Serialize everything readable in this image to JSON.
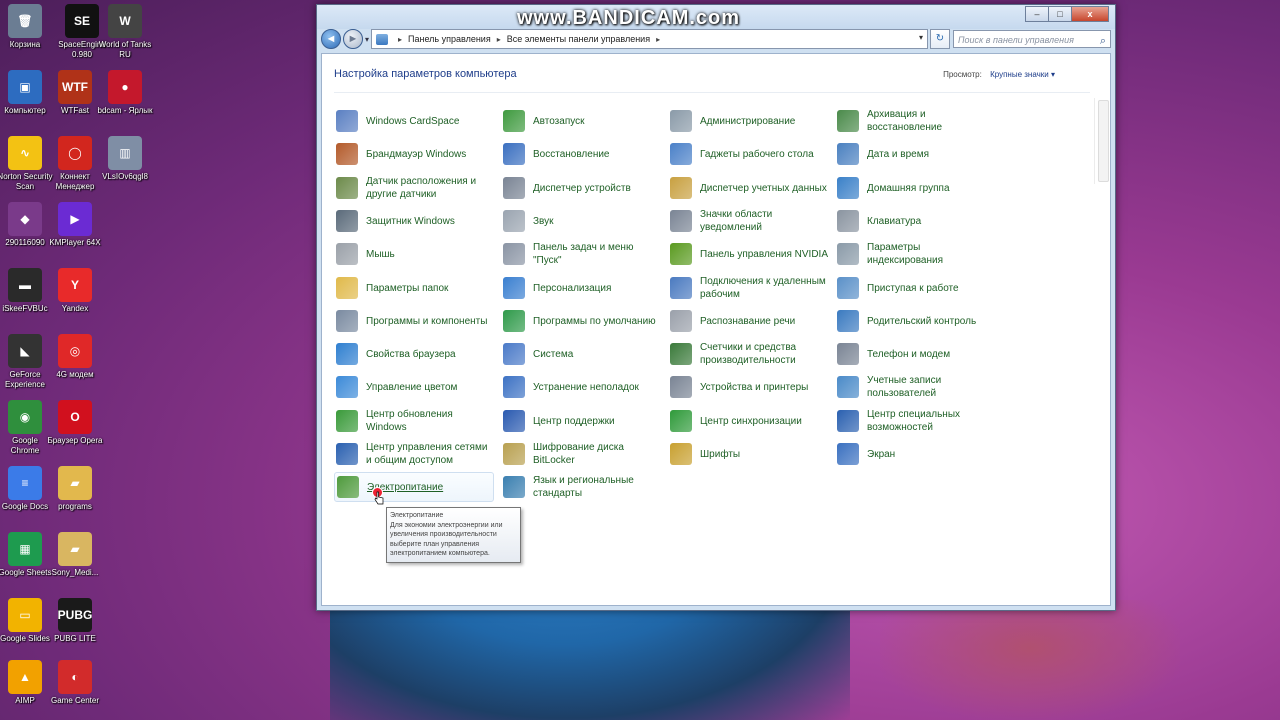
{
  "watermark": "www.BANDICAM.com",
  "desktop_icons": [
    {
      "label": "Корзина",
      "symbol": "🗑",
      "color": "#6b7d93"
    },
    {
      "label": "SpaceEngine 0.980",
      "symbol": "SE",
      "color": "#111111"
    },
    {
      "label": "World of Tanks RU",
      "symbol": "W",
      "color": "#444444"
    },
    {
      "label": "Компьютер",
      "symbol": "▣",
      "color": "#2d6cc0"
    },
    {
      "label": "WTFast",
      "symbol": "WTF",
      "color": "#b03218"
    },
    {
      "label": "bdcam - Ярлык",
      "symbol": "●",
      "color": "#c4182c"
    },
    {
      "label": "Norton Security Scan",
      "symbol": "∿",
      "color": "#f3c213"
    },
    {
      "label": "Коннект Менеджер",
      "symbol": "◯",
      "color": "#d2261e"
    },
    {
      "label": "VLsIOv6qgl8",
      "symbol": "▥",
      "color": "#7f8ea5"
    },
    {
      "label": "290116090",
      "symbol": "◆",
      "color": "#7a3a8a"
    },
    {
      "label": "KMPlayer 64X",
      "symbol": "▶",
      "color": "#6b2bd3"
    },
    {
      "label": "iSkeeFVBUc",
      "symbol": "▬",
      "color": "#2a2a2a"
    },
    {
      "label": "Yandex",
      "symbol": "Y",
      "color": "#e82a2a"
    },
    {
      "label": "GeForce Experience",
      "symbol": "◣",
      "color": "#333333"
    },
    {
      "label": "4G модем",
      "symbol": "◎",
      "color": "#e02828"
    },
    {
      "label": "Google Chrome",
      "symbol": "◉",
      "color": "#2f8f3d"
    },
    {
      "label": "Браузер Opera",
      "symbol": "O",
      "color": "#d1101e"
    },
    {
      "label": "Google Docs",
      "symbol": "≡",
      "color": "#3b7be8"
    },
    {
      "label": "programs",
      "symbol": "▰",
      "color": "#e2b84d"
    },
    {
      "label": "Google Sheets",
      "symbol": "▦",
      "color": "#1e9b4f"
    },
    {
      "label": "Sony_Medi...",
      "symbol": "▰",
      "color": "#d9b661"
    },
    {
      "label": "Google Slides",
      "symbol": "▭",
      "color": "#f2b300"
    },
    {
      "label": "PUBG LITE",
      "symbol": "PUBG",
      "color": "#1a1a1a"
    },
    {
      "label": "AIMP",
      "symbol": "▲",
      "color": "#f2a100"
    },
    {
      "label": "Game Center",
      "symbol": "◐",
      "color": "#d22b2b"
    }
  ],
  "window": {
    "minimize": "–",
    "maximize": "□",
    "close": "x",
    "back": "◄",
    "forward": "►",
    "breadcrumb": [
      "Панель управления",
      "Все элементы панели управления"
    ],
    "search_placeholder": "Поиск в панели управления",
    "page_title": "Настройка параметров компьютера",
    "view_by_label": "Просмотр:",
    "view_by_value": "Крупные значки ▾"
  },
  "columns": [
    [
      {
        "label": "Windows CardSpace",
        "color": "#5a7fc2",
        "icon": "card-icon"
      },
      {
        "label": "Брандмауэр Windows",
        "color": "#b35a2a",
        "icon": "firewall-icon"
      },
      {
        "label": "Датчик расположения и другие датчики",
        "color": "#6c8a4a",
        "icon": "sensor-icon"
      },
      {
        "label": "Защитник Windows",
        "color": "#5a6a7a",
        "icon": "defender-icon"
      },
      {
        "label": "Мышь",
        "color": "#9aa0a8",
        "icon": "mouse-icon"
      },
      {
        "label": "Параметры папок",
        "color": "#e0b94a",
        "icon": "folder-icon"
      },
      {
        "label": "Программы и компоненты",
        "color": "#7a8aa0",
        "icon": "programs-icon"
      },
      {
        "label": "Свойства браузера",
        "color": "#2f7fd0",
        "icon": "browser-icon"
      },
      {
        "label": "Управление цветом",
        "color": "#3c8ad8",
        "icon": "color-icon"
      },
      {
        "label": "Центр обновления Windows",
        "color": "#3a9a3a",
        "icon": "update-icon"
      },
      {
        "label": "Центр управления сетями и общим доступом",
        "color": "#2a60b0",
        "icon": "network-icon"
      },
      {
        "label": "Электропитание",
        "color": "#4e9a3c",
        "icon": "power-icon"
      }
    ],
    [
      {
        "label": "Автозапуск",
        "color": "#3f9a3f",
        "icon": "autoplay-icon"
      },
      {
        "label": "Восстановление",
        "color": "#3a6fc0",
        "icon": "recovery-icon"
      },
      {
        "label": "Диспетчер устройств",
        "color": "#7a8494",
        "icon": "device-manager-icon"
      },
      {
        "label": "Звук",
        "color": "#9aa4b0",
        "icon": "sound-icon"
      },
      {
        "label": "Панель задач и меню \"Пуск\"",
        "color": "#8a94a4",
        "icon": "taskbar-icon"
      },
      {
        "label": "Персонализация",
        "color": "#3a7fd0",
        "icon": "personalization-icon"
      },
      {
        "label": "Программы по умолчанию",
        "color": "#2f9a4a",
        "icon": "default-programs-icon"
      },
      {
        "label": "Система",
        "color": "#4a7ac8",
        "icon": "system-icon"
      },
      {
        "label": "Устранение неполадок",
        "color": "#3d72c4",
        "icon": "troubleshoot-icon"
      },
      {
        "label": "Центр поддержки",
        "color": "#2a5ab0",
        "icon": "action-center-icon"
      },
      {
        "label": "Шифрование диска BitLocker",
        "color": "#b8a050",
        "icon": "bitlocker-icon"
      },
      {
        "label": "Язык и региональные стандарты",
        "color": "#3a7fb0",
        "icon": "region-icon"
      }
    ],
    [
      {
        "label": "Администрирование",
        "color": "#8a9aa8",
        "icon": "admin-icon"
      },
      {
        "label": "Гаджеты рабочего стола",
        "color": "#4a80c8",
        "icon": "gadgets-icon"
      },
      {
        "label": "Диспетчер учетных данных",
        "color": "#c8a040",
        "icon": "credential-icon"
      },
      {
        "label": "Значки области уведомлений",
        "color": "#7a8494",
        "icon": "notification-icon"
      },
      {
        "label": "Панель управления NVIDIA",
        "color": "#5a9a20",
        "icon": "nvidia-icon"
      },
      {
        "label": "Подключения к удаленным рабочим",
        "color": "#4a7ac0",
        "icon": "remote-icon"
      },
      {
        "label": "Распознавание речи",
        "color": "#9aa0aa",
        "icon": "microphone-icon"
      },
      {
        "label": "Счетчики и средства производительности",
        "color": "#3a7a3a",
        "icon": "performance-icon"
      },
      {
        "label": "Устройства и принтеры",
        "color": "#7a8494",
        "icon": "printer-icon"
      },
      {
        "label": "Центр синхронизации",
        "color": "#2f9a3a",
        "icon": "sync-icon"
      },
      {
        "label": "Шрифты",
        "color": "#c8a030",
        "icon": "fonts-icon"
      }
    ],
    [
      {
        "label": "Архивация и восстановление",
        "color": "#4a8a4a",
        "icon": "backup-icon"
      },
      {
        "label": "Дата и время",
        "color": "#4a80c0",
        "icon": "datetime-icon"
      },
      {
        "label": "Домашняя группа",
        "color": "#3a80c8",
        "icon": "homegroup-icon"
      },
      {
        "label": "Клавиатура",
        "color": "#8a94a0",
        "icon": "keyboard-icon"
      },
      {
        "label": "Параметры индексирования",
        "color": "#8a9aa8",
        "icon": "indexing-icon"
      },
      {
        "label": "Приступая к работе",
        "color": "#5a90c8",
        "icon": "getting-started-icon"
      },
      {
        "label": "Родительский контроль",
        "color": "#3a7ac0",
        "icon": "parental-icon"
      },
      {
        "label": "Телефон и модем",
        "color": "#7a8494",
        "icon": "phone-icon"
      },
      {
        "label": "Учетные записи пользователей",
        "color": "#4a8ac8",
        "icon": "user-accounts-icon"
      },
      {
        "label": "Центр специальных возможностей",
        "color": "#2a60b0",
        "icon": "accessibility-icon"
      },
      {
        "label": "Экран",
        "color": "#3a70c0",
        "icon": "display-icon"
      }
    ]
  ],
  "tooltip": {
    "title": "Электропитание",
    "body": "Для экономии электроэнергии или увеличения производительности выберите план управления электропитанием компьютера."
  }
}
